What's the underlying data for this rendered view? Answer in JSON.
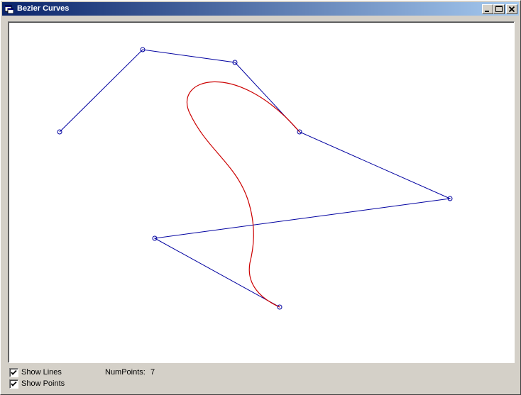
{
  "window": {
    "title": "Bezier Curves"
  },
  "controls": {
    "show_lines": {
      "label": "Show Lines",
      "checked": true
    },
    "show_points": {
      "label": "Show Points",
      "checked": true
    },
    "num_points_label": "NumPoints:",
    "num_points_value": "7"
  },
  "colors": {
    "control_polygon": "#0000a0",
    "curve": "#cc0000",
    "title_gradient_start": "#0a246a",
    "title_gradient_end": "#a6caf0"
  },
  "icons": [
    "app-icon",
    "minimize-icon",
    "maximize-icon",
    "close-icon",
    "checkmark-icon"
  ]
}
